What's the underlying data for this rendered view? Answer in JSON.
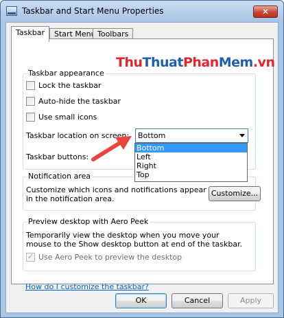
{
  "window": {
    "title": "Taskbar and Start Menu Properties",
    "close_glyph": "✕"
  },
  "tabs": [
    {
      "label": "Taskbar",
      "active": true
    },
    {
      "label": "Start Menu",
      "active": false
    },
    {
      "label": "Toolbars",
      "active": false
    }
  ],
  "taskbar_appearance": {
    "title": "Taskbar appearance",
    "lock_label": "Lock the taskbar",
    "lock_checked": false,
    "autohide_label": "Auto-hide the taskbar",
    "autohide_checked": false,
    "small_icons_label": "Use small icons",
    "small_icons_checked": false,
    "location_label": "Taskbar location on screen:",
    "location_value": "Bottom",
    "location_options": [
      "Bottom",
      "Left",
      "Right",
      "Top"
    ],
    "buttons_label": "Taskbar buttons:"
  },
  "watermark": {
    "part1": "Thu",
    "part2": "Thuat",
    "part3": "Phan",
    "part4": "Mem",
    "part5": ".vn",
    "colors": {
      "red": "#e3262b",
      "blue": "#1f5fae"
    }
  },
  "notification": {
    "title": "Notification area",
    "description": "Customize which icons and notifications appear in the notification area.",
    "customize_label": "Customize..."
  },
  "aero_peek": {
    "title": "Preview desktop with Aero Peek",
    "description": "Temporarily view the desktop when you move your mouse to the Show desktop button at end of the taskbar.",
    "checkbox_label": "Use Aero Peek to preview the desktop",
    "checkbox_checked": true,
    "checkbox_disabled": true
  },
  "help_link": "How do I customize the taskbar?",
  "buttons": {
    "ok": "OK",
    "cancel": "Cancel",
    "apply": "Apply"
  },
  "colors": {
    "selection": "#3399ff",
    "link": "#0066cc",
    "annotation_arrow": "#e8453c"
  }
}
